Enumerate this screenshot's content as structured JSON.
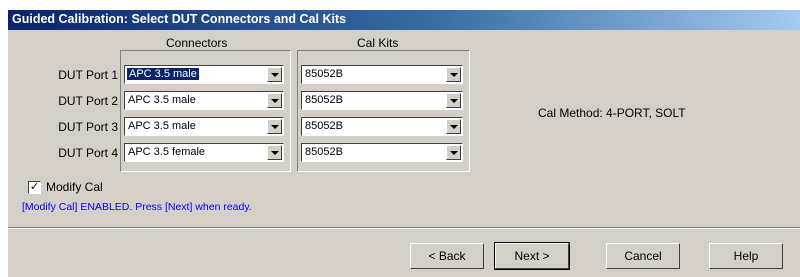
{
  "window": {
    "title": "Guided Calibration: Select DUT Connectors and Cal Kits"
  },
  "headers": {
    "connectors": "Connectors",
    "cal_kits": "Cal Kits"
  },
  "ports": [
    {
      "label": "DUT Port 1",
      "connector": "APC 3.5 male",
      "cal_kit": "85052B",
      "selected": true
    },
    {
      "label": "DUT Port 2",
      "connector": "APC 3.5 male",
      "cal_kit": "85052B"
    },
    {
      "label": "DUT Port 3",
      "connector": "APC 3.5 male",
      "cal_kit": "85052B"
    },
    {
      "label": "DUT Port 4",
      "connector": "APC 3.5 female",
      "cal_kit": "85052B"
    }
  ],
  "cal_method": "Cal Method:  4-PORT, SOLT",
  "modify_cal": {
    "label": "Modify Cal",
    "checked": true,
    "check_glyph": "✓"
  },
  "status": "[Modify Cal] ENABLED.  Press [Next] when ready.",
  "buttons": {
    "back": "< Back",
    "next": "Next >",
    "cancel": "Cancel",
    "help": "Help"
  }
}
